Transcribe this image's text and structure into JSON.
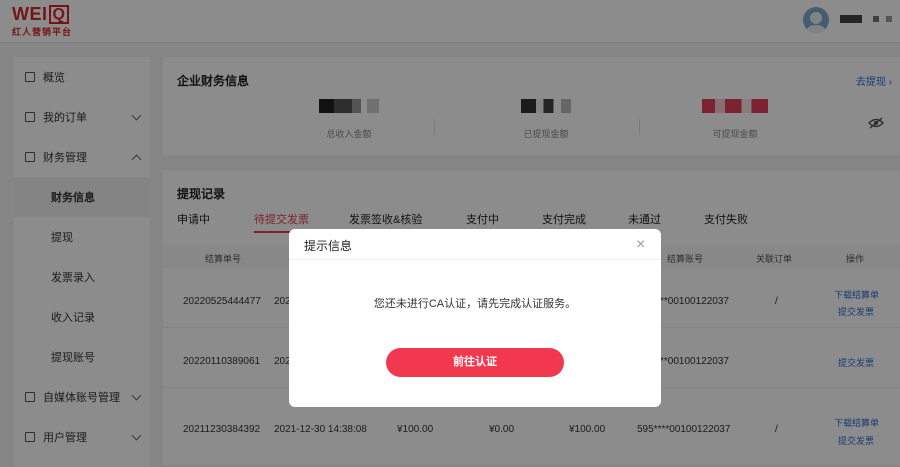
{
  "brand": {
    "logo_text": "WEIQ",
    "tagline": "红人营销平台",
    "color": "#d4282d"
  },
  "header": {
    "avatar_icon": "user-avatar"
  },
  "sidebar": {
    "items": [
      {
        "label": "概览",
        "icon": "overview-grid-icon"
      },
      {
        "label": "我的订单",
        "icon": "order-doc-icon"
      },
      {
        "label": "财务管理",
        "icon": "finance-icon"
      },
      {
        "label": "自媒体账号管理",
        "icon": "media-account-icon"
      },
      {
        "label": "用户管理",
        "icon": "user-manage-icon"
      }
    ],
    "finance_sub": [
      "财务信息",
      "提现",
      "发票录入",
      "收入记录",
      "提现账号"
    ]
  },
  "finance": {
    "title": "企业财务信息",
    "withdraw_link": "去提现",
    "labels": [
      "总收入金额",
      "已提现金额",
      "可提现金额"
    ]
  },
  "records": {
    "title": "提现记录",
    "tabs": [
      "申请中",
      "待提交发票",
      "发票签收&核验",
      "支付中",
      "支付完成",
      "未通过",
      "支付失败"
    ],
    "active_tab": "待提交发票",
    "columns": [
      "结算单号",
      "结算账号",
      "关联订单",
      "操作"
    ],
    "rows": [
      {
        "id": "20220525444477",
        "time": "202",
        "account": "**00100122037",
        "order": "/",
        "action1": "下载结算单",
        "action2": "提交发票"
      },
      {
        "id": "20220110389061",
        "time": "202",
        "account": "**00100122037",
        "order": "/",
        "action1": "",
        "action2": "提交发票"
      },
      {
        "id": "20211230384392",
        "time": "2021-12-30 14:38:08",
        "amt1": "¥100.00",
        "amt2": "¥0.00",
        "amt3": "¥100.00",
        "account": "595****00100122037",
        "order": "/",
        "action1": "下载结算单",
        "action2": "提交发票"
      }
    ]
  },
  "modal": {
    "title": "提示信息",
    "message": "您还未进行CA认证，请先完成认证服务。",
    "button": "前往认证",
    "close": "×",
    "accent": "#f2384f"
  }
}
